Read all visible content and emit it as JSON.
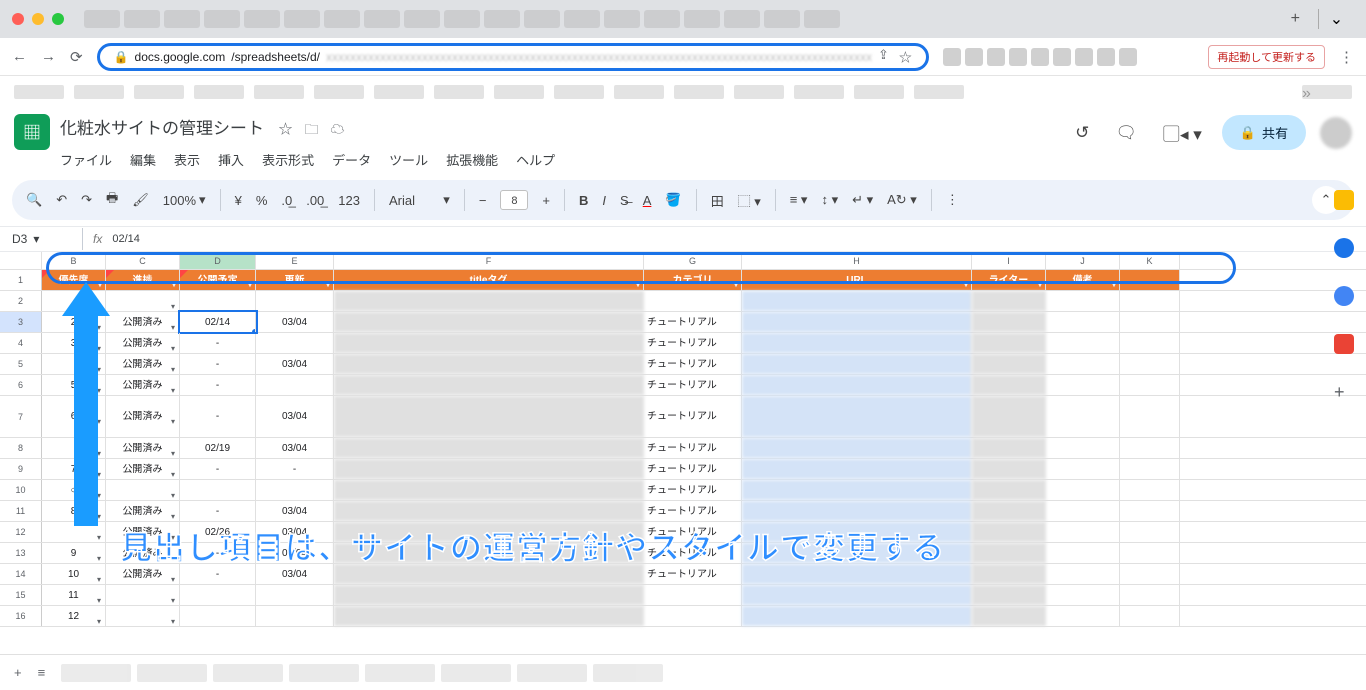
{
  "browser": {
    "url_host": "docs.google.com",
    "url_path": "/spreadsheets/d/",
    "restart_label": "再起動して更新する",
    "traffic": [
      "#ff5f57",
      "#febc2e",
      "#28c840"
    ]
  },
  "doc": {
    "title": "化粧水サイトの管理シート",
    "menus": [
      "ファイル",
      "編集",
      "表示",
      "挿入",
      "表示形式",
      "データ",
      "ツール",
      "拡張機能",
      "ヘルプ"
    ],
    "share": "共有"
  },
  "toolbar": {
    "zoom": "100%",
    "currency": "¥",
    "pct": "%",
    "font": "Arial",
    "font_size": "8"
  },
  "formula": {
    "name_box": "D3",
    "value": "02/14"
  },
  "columns": [
    "B",
    "C",
    "D",
    "E",
    "F",
    "G",
    "H",
    "I",
    "J",
    "K"
  ],
  "headers": {
    "B": "優先度",
    "C": "進捗",
    "D": "公開予定",
    "E": "更新",
    "F": "titleタグ",
    "G": "カテゴリ",
    "H": "URL",
    "I": "ライター",
    "J": "備考"
  },
  "rows": [
    {
      "n": 2,
      "B": "",
      "C": "",
      "D": "",
      "E": "",
      "G": ""
    },
    {
      "n": 3,
      "B": "2",
      "C": "公開済み",
      "D": "02/14",
      "E": "03/04",
      "G": "チュートリアル"
    },
    {
      "n": 4,
      "B": "3",
      "C": "公開済み",
      "D": "-",
      "E": "",
      "G": "チュートリアル"
    },
    {
      "n": 5,
      "B": "",
      "C": "公開済み",
      "D": "-",
      "E": "03/04",
      "G": "チュートリアル"
    },
    {
      "n": 6,
      "B": "5",
      "C": "公開済み",
      "D": "-",
      "E": "",
      "G": "チュートリアル"
    },
    {
      "n": 7,
      "B": "6",
      "C": "公開済み",
      "D": "-",
      "E": "03/04",
      "G": "チュートリアル",
      "tall": true
    },
    {
      "n": 8,
      "B": "",
      "C": "公開済み",
      "D": "02/19",
      "E": "03/04",
      "G": "チュートリアル"
    },
    {
      "n": 9,
      "B": "7",
      "C": "公開済み",
      "D": "-",
      "E": "-",
      "G": "チュートリアル"
    },
    {
      "n": 10,
      "B": "○",
      "C": "",
      "D": "",
      "E": "",
      "G": "チュートリアル"
    },
    {
      "n": 11,
      "B": "8",
      "C": "公開済み",
      "D": "-",
      "E": "03/04",
      "G": "チュートリアル"
    },
    {
      "n": 12,
      "B": "",
      "C": "公開済み",
      "D": "02/26",
      "E": "03/04",
      "G": "チュートリアル"
    },
    {
      "n": 13,
      "B": "9",
      "C": "公開済み",
      "D": "-",
      "E": "03/04",
      "G": "チュートリアル"
    },
    {
      "n": 14,
      "B": "10",
      "C": "公開済み",
      "D": "-",
      "E": "03/04",
      "G": "チュートリアル"
    },
    {
      "n": 15,
      "B": "11",
      "C": "",
      "D": "",
      "E": "",
      "G": ""
    },
    {
      "n": 16,
      "B": "12",
      "C": "",
      "D": "",
      "E": "",
      "G": ""
    }
  ],
  "caption": "見出し項目は、サイトの運営方針やスタイルで変更する",
  "side_colors": [
    "#fbbc04",
    "#1a73e8",
    "#34a853",
    "#ea4335",
    "#5f6368"
  ]
}
